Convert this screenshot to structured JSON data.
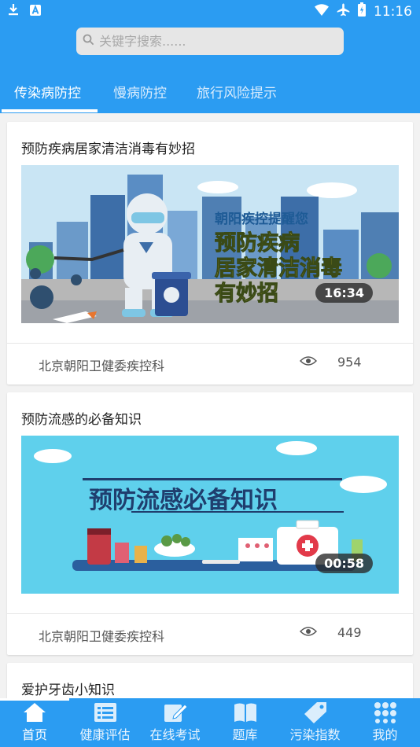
{
  "status_bar": {
    "time": "11:16"
  },
  "search": {
    "placeholder": "关键字搜索......"
  },
  "tabs": [
    {
      "label": "传染病防控"
    },
    {
      "label": "慢病防控"
    },
    {
      "label": "旅行风险提示"
    }
  ],
  "cards": [
    {
      "title": "预防疾病居家清洁消毒有妙招",
      "image_banner": "朝阳疾控提醒您",
      "image_lines": [
        "预防疾病",
        "居家清洁消毒",
        "有妙招"
      ],
      "duration": "16:34",
      "source": "北京朝阳卫健委疾控科",
      "views": "954"
    },
    {
      "title": "预防流感的必备知识",
      "image_heading": "预防流感必备知识",
      "duration": "00:58",
      "source": "北京朝阳卫健委疾控科",
      "views": "449"
    },
    {
      "title": "爱护牙齿小知识"
    }
  ],
  "bottom_nav": [
    {
      "label": "首页",
      "icon": "home-icon"
    },
    {
      "label": "健康评估",
      "icon": "list-icon"
    },
    {
      "label": "在线考试",
      "icon": "edit-icon"
    },
    {
      "label": "题库",
      "icon": "book-icon"
    },
    {
      "label": "污染指数",
      "icon": "tag-icon"
    },
    {
      "label": "我的",
      "icon": "grid-icon"
    }
  ],
  "colors": {
    "primary": "#2b9cf2"
  }
}
